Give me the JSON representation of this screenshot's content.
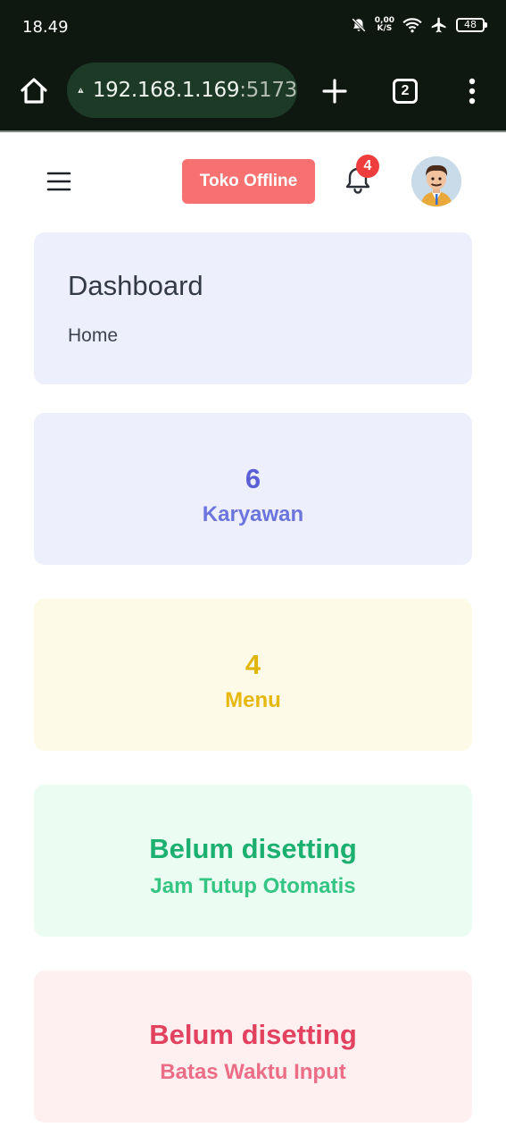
{
  "status_bar": {
    "time": "18.49",
    "net_speed_value": "0,00",
    "net_speed_unit": "K/S",
    "battery": "48"
  },
  "browser": {
    "url_host": "192.168.1.169",
    "url_port": ":5173",
    "tab_count": "2"
  },
  "header": {
    "store_status_label": "Toko Offline",
    "notification_count": "4"
  },
  "dashboard": {
    "title": "Dashboard",
    "breadcrumb": "Home"
  },
  "stats": {
    "karyawan": {
      "value": "6",
      "label": "Karyawan"
    },
    "menu": {
      "value": "4",
      "label": "Menu"
    },
    "jam_tutup": {
      "value": "Belum disetting",
      "label": "Jam Tutup Otomatis"
    },
    "batas_waktu": {
      "value": "Belum disetting",
      "label": "Batas Waktu Input"
    }
  },
  "colors": {
    "toko_button": "#f87171",
    "notification_badge": "#ef3d3d",
    "karyawan_accent": "#5b5fd6",
    "menu_accent": "#e2b50a",
    "jam_accent": "#1bb06f",
    "batas_accent": "#e2425f"
  },
  "icons": {
    "status": [
      "mute-bell-icon",
      "wifi-icon",
      "airplane-icon",
      "battery-icon"
    ],
    "browser": [
      "home-icon",
      "warning-icon",
      "plus-icon",
      "tabs-icon",
      "more-vert-icon"
    ],
    "header": [
      "hamburger-icon",
      "bell-icon",
      "avatar"
    ]
  }
}
